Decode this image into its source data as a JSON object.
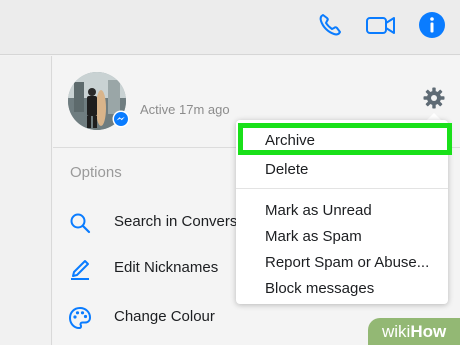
{
  "header": {
    "phone_icon": "phone-icon",
    "video_icon": "video-camera-icon",
    "info_icon": "info-icon",
    "accent": "#0a7cff"
  },
  "profile": {
    "active_status": "Active 17m ago"
  },
  "options": {
    "heading": "Options",
    "items": [
      {
        "label": "Search in Conversation",
        "icon": "search-icon"
      },
      {
        "label": "Edit Nicknames",
        "icon": "pencil-icon"
      },
      {
        "label": "Change Colour",
        "icon": "palette-icon"
      }
    ]
  },
  "context_menu": {
    "highlight_color": "#19e019",
    "items": [
      {
        "label": "Archive"
      },
      {
        "label": "Delete"
      },
      {
        "label": "Mark as Unread"
      },
      {
        "label": "Mark as Spam"
      },
      {
        "label": "Report Spam or Abuse..."
      },
      {
        "label": "Block messages"
      }
    ]
  },
  "watermark": {
    "part1": "wiki",
    "part2": "How"
  }
}
